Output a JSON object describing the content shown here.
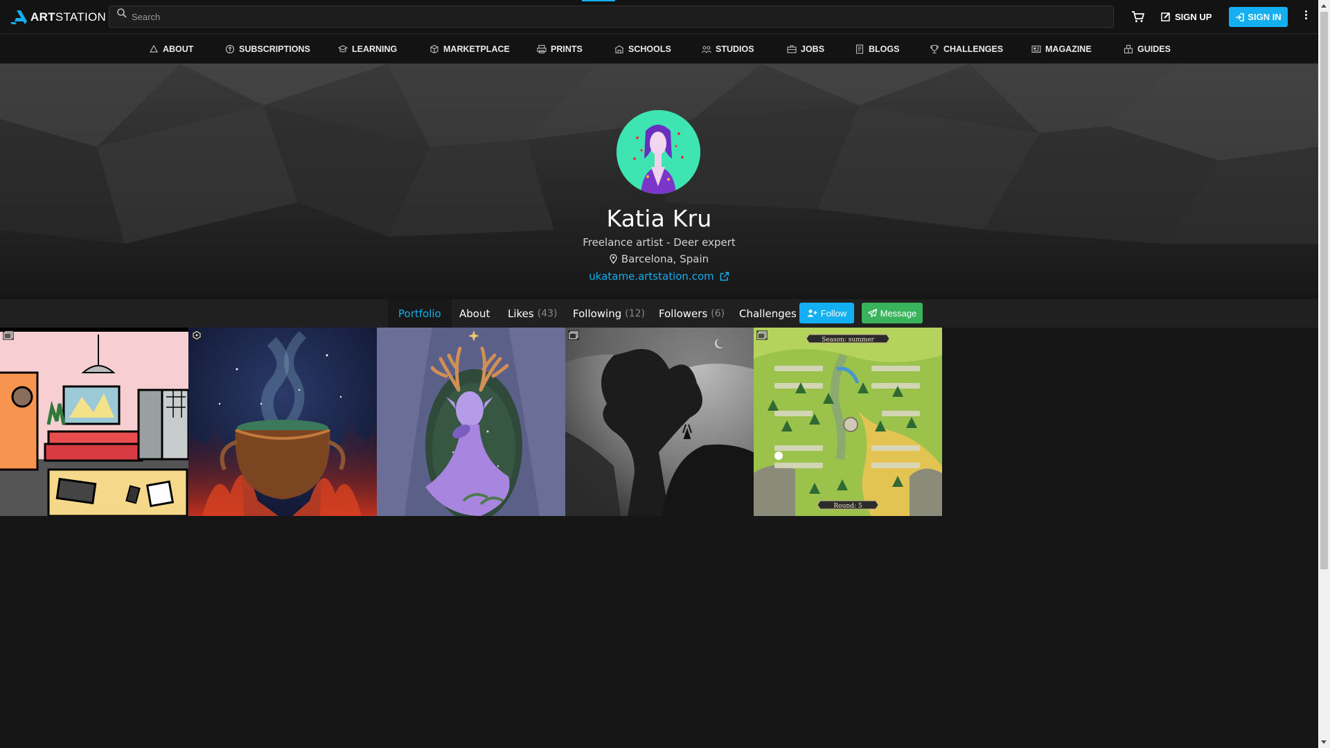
{
  "header": {
    "logo_bold": "ART",
    "logo_light": "STATION",
    "logo_icon": "artstation-logo-icon",
    "search_placeholder": "Search",
    "search_icon": "search-icon",
    "cart_icon": "cart-icon",
    "signup_label": "SIGN UP",
    "signin_label": "SIGN IN",
    "menu_icon": "vertical-dots-icon",
    "accent_color": "#13aff0"
  },
  "nav": {
    "items": [
      {
        "label": "ABOUT",
        "icon": "about-icon"
      },
      {
        "label": "SUBSCRIPTIONS",
        "icon": "subscriptions-icon"
      },
      {
        "label": "LEARNING",
        "icon": "learning-icon"
      },
      {
        "label": "MARKETPLACE",
        "icon": "marketplace-icon"
      },
      {
        "label": "PRINTS",
        "icon": "prints-icon"
      },
      {
        "label": "SCHOOLS",
        "icon": "schools-icon"
      },
      {
        "label": "STUDIOS",
        "icon": "studios-icon"
      },
      {
        "label": "JOBS",
        "icon": "jobs-icon"
      },
      {
        "label": "BLOGS",
        "icon": "blogs-icon"
      },
      {
        "label": "CHALLENGES",
        "icon": "challenges-icon"
      },
      {
        "label": "MAGAZINE",
        "icon": "magazine-icon"
      },
      {
        "label": "GUIDES",
        "icon": "guides-icon"
      }
    ]
  },
  "profile": {
    "name": "Katia Kru",
    "headline": "Freelance artist - Deer expert",
    "location": "Barcelona, Spain",
    "website": "ukatame.artstation.com"
  },
  "tabs": {
    "portfolio": "Portfolio",
    "about": "About",
    "likes": "Likes",
    "likes_count": "(43)",
    "following": "Following",
    "following_count": "(12)",
    "followers": "Followers",
    "followers_count": "(6)",
    "challenges": "Challenges",
    "follow_button": "Follow",
    "message_button": "Message",
    "follow_color": "#13aff0",
    "message_color": "#3ab45c"
  },
  "gallery": {
    "items": [
      {
        "subject": "cartoon living room illustration",
        "type_icon": "image-set-icon"
      },
      {
        "subject": "witch cauldron over fire",
        "type_icon": "3d-view-icon"
      },
      {
        "subject": "purple deer with antlers",
        "type_icon": "none"
      },
      {
        "subject": "dark tree with deer silhouette",
        "type_icon": "image-set-icon"
      },
      {
        "subject": "board game map",
        "type_icon": "image-set-icon",
        "banner_top": "Season: summer",
        "banner_bottom": "Round: 5"
      }
    ]
  }
}
